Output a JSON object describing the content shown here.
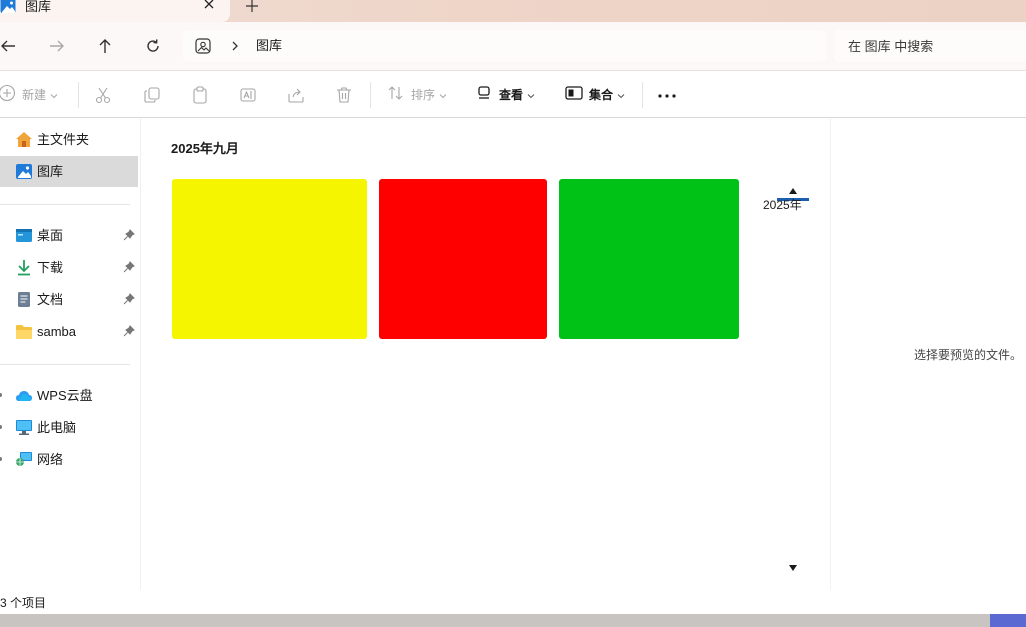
{
  "window": {
    "tab_title": "图库",
    "tab_icon": "gallery-icon",
    "new_tab_symbol": "+"
  },
  "navigation": {
    "back": "back-arrow-icon",
    "forward": "forward-arrow-icon",
    "up": "up-arrow-icon",
    "refresh": "refresh-icon",
    "breadcrumb": [
      "图库"
    ],
    "search_placeholder": "在 图库 中搜索"
  },
  "toolbar": {
    "new_label": "新建",
    "sort_label": "排序",
    "view_label": "查看",
    "collection_label": "集合",
    "more_symbol": "···",
    "icons": [
      "cut-icon",
      "copy-icon",
      "paste-icon",
      "rename-icon",
      "share-icon",
      "delete-icon"
    ]
  },
  "sidebar": {
    "items": [
      {
        "label": "主文件夹",
        "icon": "home-icon",
        "selected": false,
        "pinned": false
      },
      {
        "label": "图库",
        "icon": "gallery-icon",
        "selected": true,
        "pinned": false
      },
      {
        "label": "桌面",
        "icon": "desktop-icon",
        "selected": false,
        "pinned": true
      },
      {
        "label": "下载",
        "icon": "download-icon",
        "selected": false,
        "pinned": true
      },
      {
        "label": "文档",
        "icon": "document-icon",
        "selected": false,
        "pinned": true
      },
      {
        "label": "samba",
        "icon": "folder-icon",
        "selected": false,
        "pinned": true
      },
      {
        "label": "WPS云盘",
        "icon": "cloud-icon",
        "selected": false,
        "pinned": false
      },
      {
        "label": "此电脑",
        "icon": "computer-icon",
        "selected": false,
        "pinned": false
      },
      {
        "label": "网络",
        "icon": "network-icon",
        "selected": false,
        "pinned": false
      }
    ]
  },
  "gallery": {
    "group_title": "2025年九月",
    "thumbnails": [
      {
        "color": "#f5f500"
      },
      {
        "color": "#ff0000"
      },
      {
        "color": "#00c116"
      }
    ],
    "timeline_year": "2025年"
  },
  "preview": {
    "message": "选择要预览的文件。"
  },
  "status": {
    "item_count": "3 个项目"
  },
  "colors": {
    "accent": "#1c5fb0",
    "selected_bg": "#dadada",
    "titlebar": "#eed5c8"
  }
}
